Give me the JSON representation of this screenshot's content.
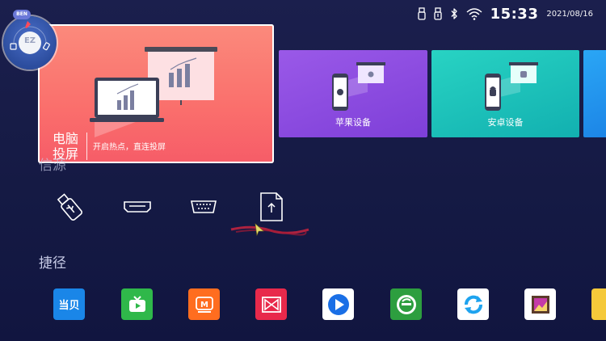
{
  "status_bar": {
    "time": "15:33",
    "date": "2021/08/16",
    "icons": [
      "usb-icon",
      "usb-icon-2",
      "bluetooth-icon",
      "wifi-icon"
    ]
  },
  "floating_widget": {
    "center_label": "EZ",
    "badge": "BEN"
  },
  "cards": {
    "main": {
      "title": "电脑\n投屏",
      "subtitle": "开启热点，直连投屏",
      "color": "#fa6f6c"
    },
    "apple": {
      "label": "苹果设备",
      "color": "#8a4be0"
    },
    "android": {
      "label": "安卓设备",
      "color": "#1cc0ba"
    },
    "extra": {
      "color": "#2398ee"
    }
  },
  "source": {
    "label": "信源",
    "items": [
      "usb-drive-icon",
      "hdmi-icon",
      "vga-icon",
      "file-upload-icon"
    ]
  },
  "shortcuts": {
    "label": "捷径",
    "apps": [
      {
        "name": "dangbei-app",
        "text": "当贝",
        "color": "#1a86e8"
      },
      {
        "name": "tv-app",
        "color": "#2fb84a"
      },
      {
        "name": "mango-tv-app",
        "color": "#ff6d1f"
      },
      {
        "name": "bowtie-app",
        "color": "#e8294b"
      },
      {
        "name": "video-player-app",
        "color": "#1a6fe6"
      },
      {
        "name": "green-e-app",
        "color": "#2d9e3f"
      },
      {
        "name": "refresh-app",
        "color": "#1ea3ef"
      },
      {
        "name": "gallery-app",
        "color": "#ffffff"
      },
      {
        "name": "yellow-app",
        "color": "#f5c93a"
      }
    ]
  }
}
